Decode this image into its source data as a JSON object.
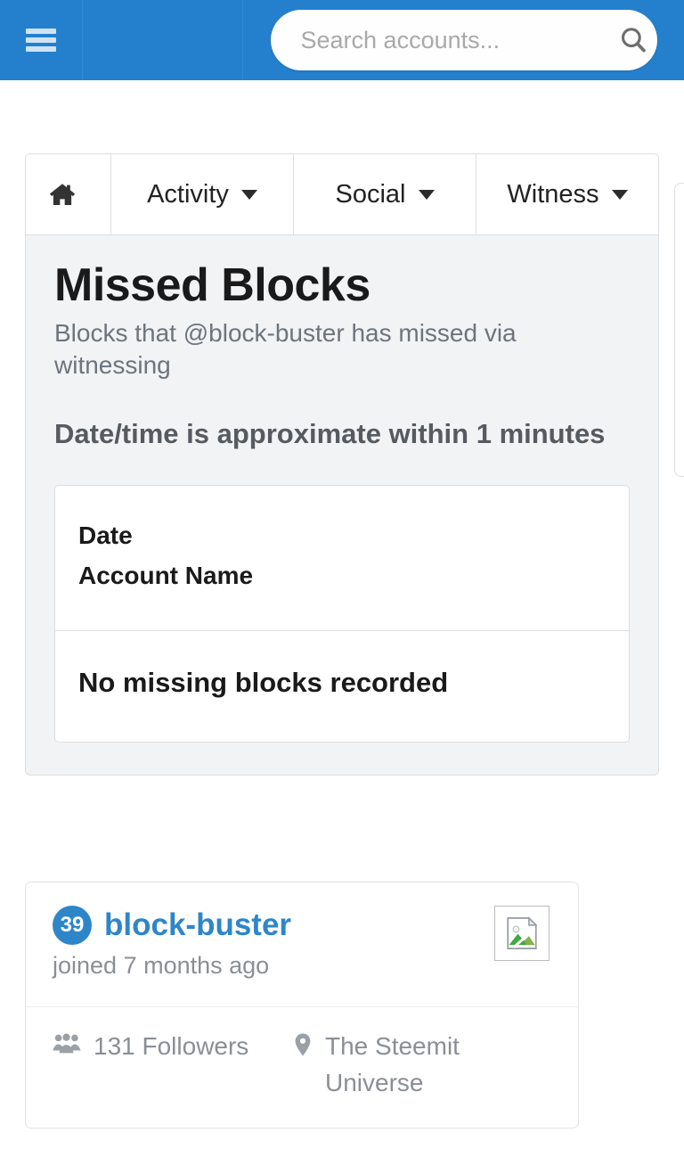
{
  "header": {
    "menu_icon": "hamburger-icon",
    "search": {
      "placeholder": "Search accounts...",
      "value": "",
      "icon": "search-icon"
    },
    "background_color": "#2480cc"
  },
  "tabs": [
    {
      "label": "",
      "icon": "home-icon",
      "has_caret": false
    },
    {
      "label": "Activity",
      "icon": "",
      "has_caret": true
    },
    {
      "label": "Social",
      "icon": "",
      "has_caret": true
    },
    {
      "label": "Witness",
      "icon": "",
      "has_caret": true
    }
  ],
  "main": {
    "title": "Missed Blocks",
    "subtitle": "Blocks that @block-buster has missed via witnessing",
    "approx_note": "Date/time is approximate within 1 minutes",
    "table": {
      "columns": [
        "Date",
        "Account Name"
      ],
      "rows": [],
      "empty_message": "No missing blocks recorded"
    }
  },
  "profile": {
    "reputation": "39",
    "username": "block-buster",
    "joined": "joined 7 months ago",
    "avatar_icon": "broken-image-icon",
    "followers_count": "131",
    "followers_label": "Followers",
    "followers_icon": "users-icon",
    "location": "The Steemit Universe",
    "location_icon": "map-pin-icon"
  },
  "colors": {
    "brand_blue": "#2480cc",
    "link_blue": "#2e86c9",
    "panel_bg": "#f2f3f5",
    "muted_text": "#8a8f94"
  }
}
